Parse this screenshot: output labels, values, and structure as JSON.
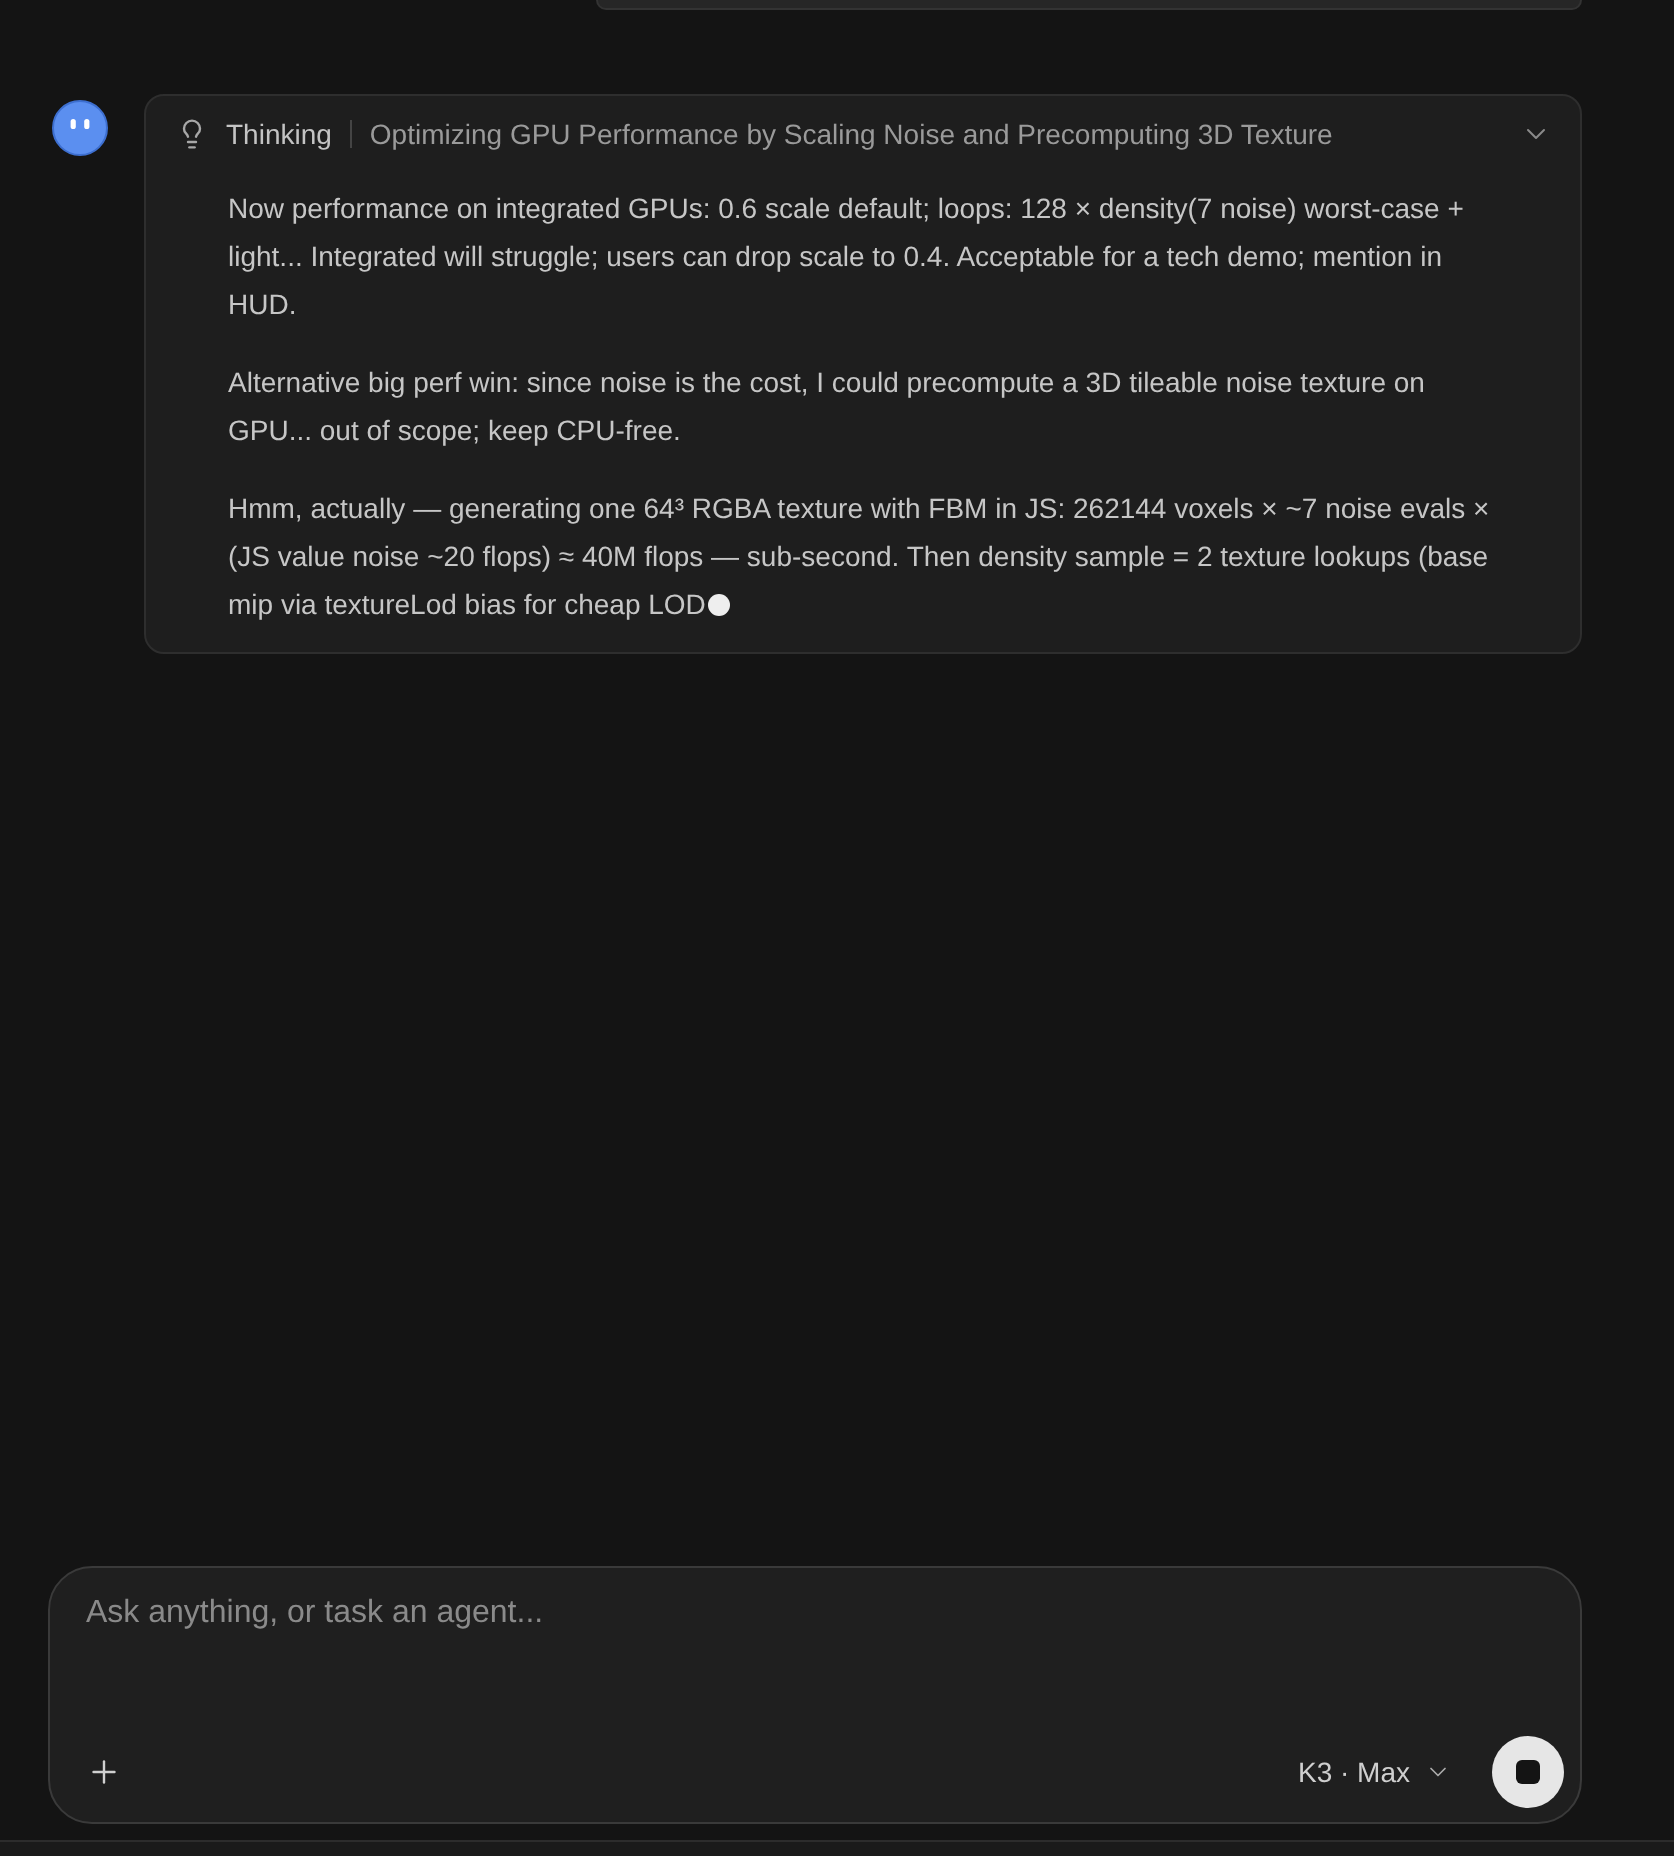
{
  "thinking": {
    "label": "Thinking",
    "title": "Optimizing GPU Performance by Scaling Noise and Precomputing 3D Texture",
    "expanded": true,
    "streaming": true,
    "paragraphs": [
      "Now performance on integrated GPUs: 0.6 scale default; loops: 128 × density(7 noise) worst-case + light... Integrated will struggle; users can drop scale to 0.4. Acceptable for a tech demo; mention in HUD.",
      "Alternative big perf win: since noise is the cost, I could precompute a 3D tileable noise texture on GPU... out of scope; keep CPU-free.",
      "Hmm, actually — generating one 64³ RGBA texture with FBM in JS: 262144 voxels × ~7 noise evals × (JS value noise ~20 flops) ≈ 40M flops — sub-second. Then density sample = 2 texture lookups (base mip via textureLod bias for cheap LOD"
    ]
  },
  "composer": {
    "placeholder": "Ask anything, or task an agent...",
    "model": "K3 · Max",
    "generating": true
  }
}
